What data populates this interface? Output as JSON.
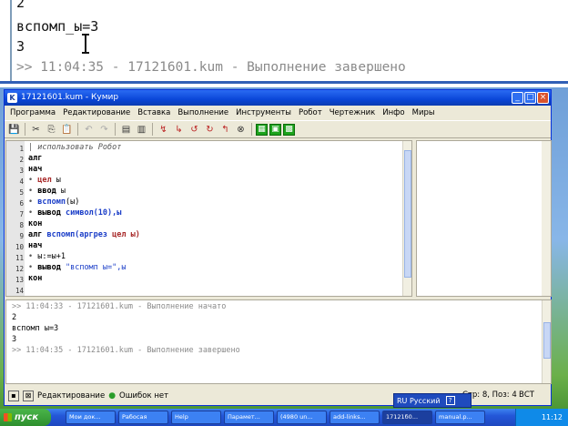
{
  "zoom": {
    "line1": "2",
    "line2": "вспомп_ы=3",
    "line3": "3",
    "line4": ">> 11:04:35 - 17121601.kum - Выполнение завершено"
  },
  "window": {
    "title": "17121601.kum - Кумир",
    "menu": [
      "Программа",
      "Редактирование",
      "Вставка",
      "Выполнение",
      "Инструменты",
      "Робот",
      "Чертежник",
      "Инфо",
      "Миры"
    ]
  },
  "editor": {
    "line_numbers": [
      "1",
      "2",
      "3",
      "4",
      "5",
      "6",
      "7",
      "8",
      "9",
      "10",
      "11",
      "12",
      "13",
      "14"
    ],
    "lines": [
      {
        "pre": "| ",
        "a": "использовать Робот",
        "b": "",
        "c": ""
      },
      {
        "pre": "",
        "a": "алг",
        "b": "",
        "c": ""
      },
      {
        "pre": "",
        "a": "нач",
        "b": "",
        "c": ""
      },
      {
        "pre": "• ",
        "a": "цел",
        "b": " ы",
        "c": ""
      },
      {
        "pre": "• ",
        "a": "ввод",
        "b": " ы",
        "c": ""
      },
      {
        "pre": "• ",
        "a": "вспомп",
        "b": "(ы)",
        "c": ""
      },
      {
        "pre": "• ",
        "a": "вывод",
        "b": " ",
        "c": "символ(10),ы"
      },
      {
        "pre": "",
        "a": "кон",
        "b": "",
        "c": ""
      },
      {
        "pre": "",
        "a": "алг",
        "b": " вспомп(аргрез ",
        "c": "цел ы)"
      },
      {
        "pre": "",
        "a": "нач",
        "b": "",
        "c": ""
      },
      {
        "pre": "• ",
        "a": "ы:=ы+1",
        "b": "",
        "c": ""
      },
      {
        "pre": "• ",
        "a": "вывод",
        "b": " ",
        "c": "\"вспомп ы=\",ы"
      },
      {
        "pre": "",
        "a": "кон",
        "b": "",
        "c": ""
      },
      {
        "pre": "",
        "a": "",
        "b": "",
        "c": ""
      }
    ]
  },
  "output": {
    "lines": [
      ">> 11:04:33 - 17121601.kum - Выполнение начато",
      "2",
      "вспомп ы=3",
      "3",
      ">> 11:04:35 - 17121601.kum - Выполнение завершено"
    ]
  },
  "status": {
    "mode": "Редактирование",
    "errors": "Ошибок нет",
    "position": "Стр: 8, Поз: 4",
    "insert": "ВСТ",
    "language": "RU Русский"
  },
  "taskbar": {
    "start": "пуск",
    "tasks": [
      "Мои док...",
      "Рабосая",
      "Help",
      "Парамет...",
      "(4980 un...",
      "add-links...",
      "17121б0...",
      "manual.p..."
    ],
    "clock": "11:12"
  }
}
